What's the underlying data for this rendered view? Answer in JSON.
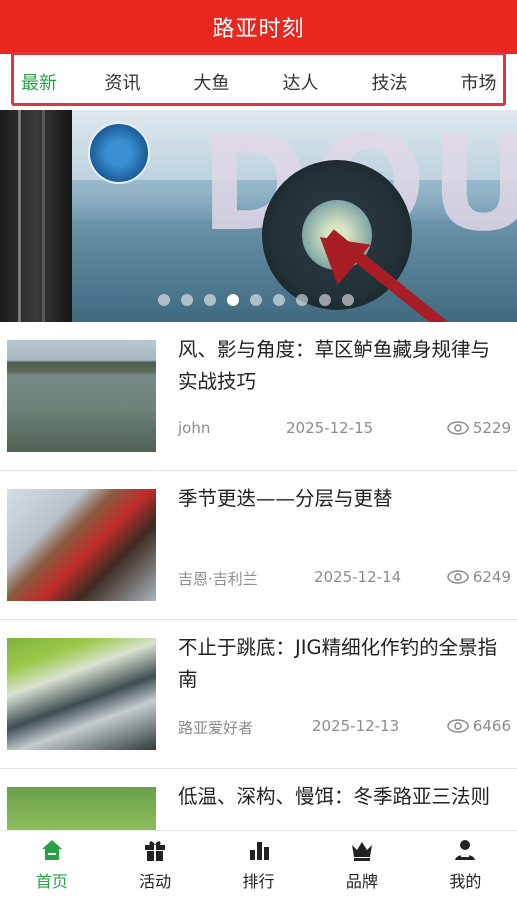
{
  "header": {
    "title": "路亚时刻"
  },
  "tabs": [
    {
      "label": "最新",
      "active": true
    },
    {
      "label": "资讯",
      "active": false
    },
    {
      "label": "大鱼",
      "active": false
    },
    {
      "label": "达人",
      "active": false
    },
    {
      "label": "技法",
      "active": false
    },
    {
      "label": "市场",
      "active": false
    }
  ],
  "banner": {
    "overlay_text": "DOU",
    "slide_count": 9,
    "active_slide": 4
  },
  "articles": [
    {
      "title": "风、影与角度：草区鲈鱼藏身规律与实战技巧",
      "author": "john",
      "date": "2025-12-15",
      "views": "5229"
    },
    {
      "title": "季节更迭——分层与更替",
      "author": "吉恩·吉利兰",
      "date": "2025-12-14",
      "views": "6249"
    },
    {
      "title": "不止于跳底：JIG精细化作钓的全景指南",
      "author": "路亚爱好者",
      "date": "2025-12-13",
      "views": "6466"
    },
    {
      "title": "低温、深构、慢饵：冬季路亚三法则",
      "author": "",
      "date": "",
      "views": ""
    }
  ],
  "bottom_nav": [
    {
      "label": "首页",
      "icon": "home-icon",
      "active": true
    },
    {
      "label": "活动",
      "icon": "gift-icon",
      "active": false
    },
    {
      "label": "排行",
      "icon": "bar-chart-icon",
      "active": false
    },
    {
      "label": "品牌",
      "icon": "crown-icon",
      "active": false
    },
    {
      "label": "我的",
      "icon": "user-icon",
      "active": false
    }
  ],
  "colors": {
    "header": "#e8281f",
    "accent": "#27a243",
    "annotation": "#e0353a"
  }
}
